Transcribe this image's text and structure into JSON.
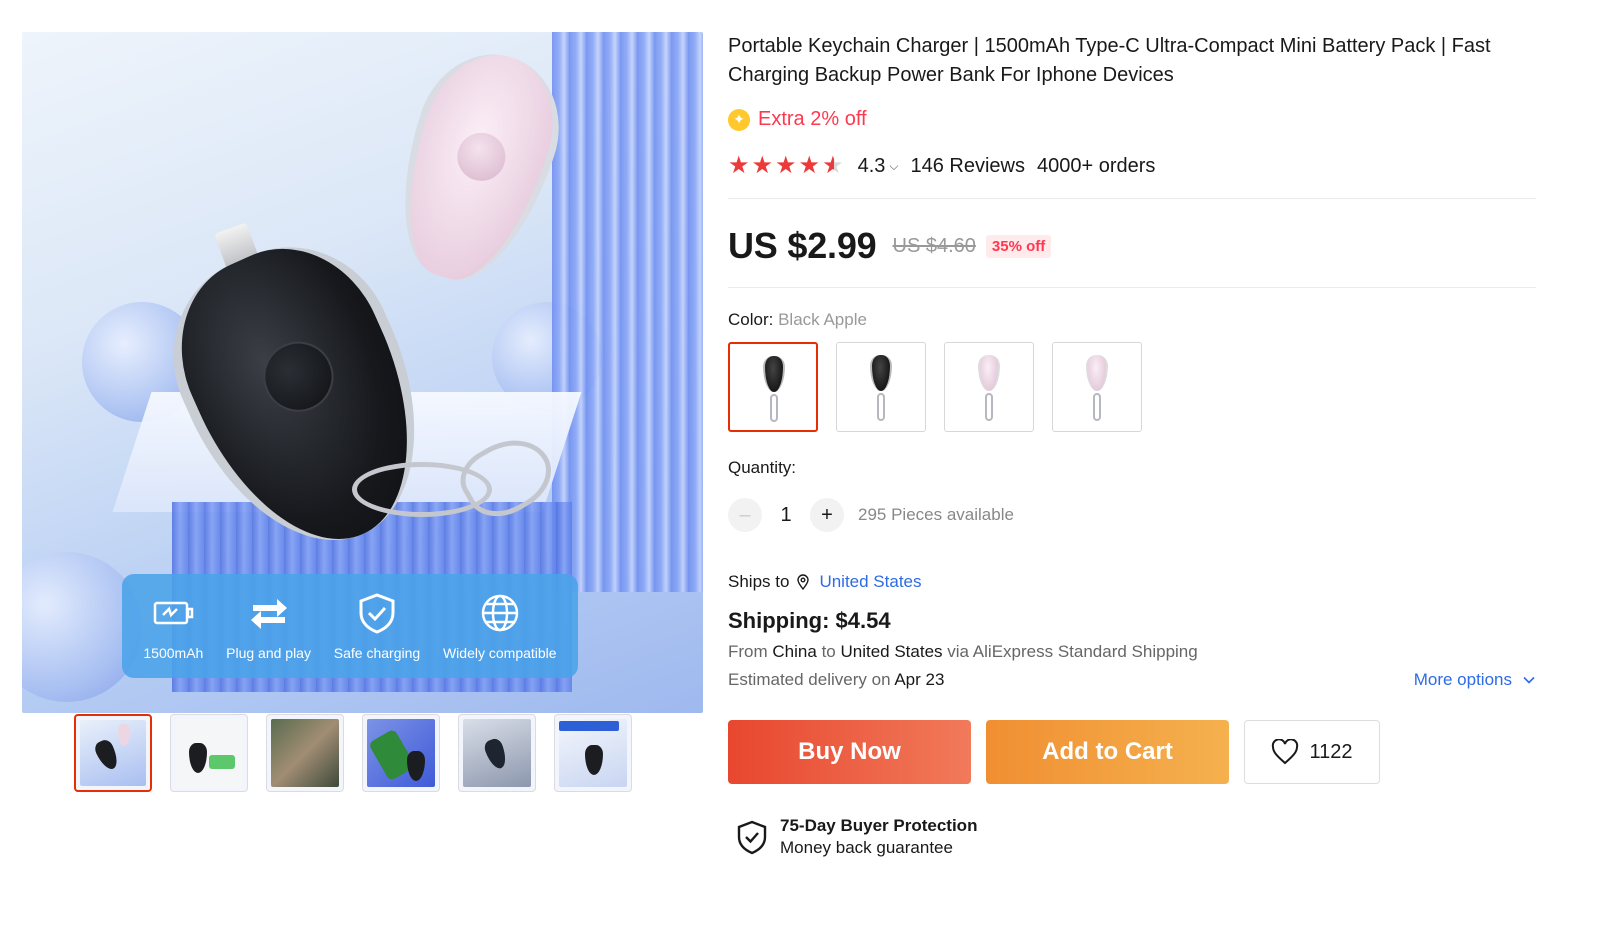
{
  "product": {
    "title": "Portable Keychain Charger | 1500mAh Type-C Ultra-Compact Mini Battery Pack | Fast Charging Backup Power Bank For Iphone Devices",
    "extra_discount": "Extra 2% off",
    "rating": "4.3",
    "rating_stars": 4.3,
    "reviews": "146 Reviews",
    "orders": "4000+ orders",
    "price": "US $2.99",
    "original_price": "US $4.60",
    "discount_badge": "35% off"
  },
  "gallery": {
    "features": [
      {
        "icon": "battery-icon",
        "label": "1500mAh"
      },
      {
        "icon": "arrows-icon",
        "label": "Plug and play"
      },
      {
        "icon": "shield-check-icon",
        "label": "Safe charging"
      },
      {
        "icon": "globe-icon",
        "label": "Widely compatible"
      }
    ],
    "thumbnail_count": 6,
    "active_thumbnail": 0
  },
  "color": {
    "label": "Color:",
    "selected": "Black Apple",
    "options": [
      "black",
      "black",
      "pink",
      "pink"
    ]
  },
  "quantity": {
    "label": "Quantity:",
    "value": "1",
    "minus": "–",
    "plus": "+",
    "available": "295 Pieces available"
  },
  "shipping": {
    "ships_to_label": "Ships to",
    "ships_to": "United States",
    "cost": "Shipping: $4.54",
    "from_prefix": "From",
    "from": "China",
    "to_prefix": "to",
    "to": "United States",
    "via": "via AliExpress Standard Shipping",
    "eta_prefix": "Estimated delivery on",
    "eta": "Apr 23",
    "more_options": "More options"
  },
  "actions": {
    "buy_now": "Buy Now",
    "add_to_cart": "Add to Cart",
    "wishlist_count": "1122"
  },
  "protection": {
    "title": "75-Day Buyer Protection",
    "subtitle": "Money back guarantee"
  },
  "colors": {
    "accent_red": "#e62e04",
    "price_red": "#fd384f",
    "link_blue": "#2e6be6",
    "buy_now": "#e8472f",
    "add_to_cart": "#f08f32"
  }
}
